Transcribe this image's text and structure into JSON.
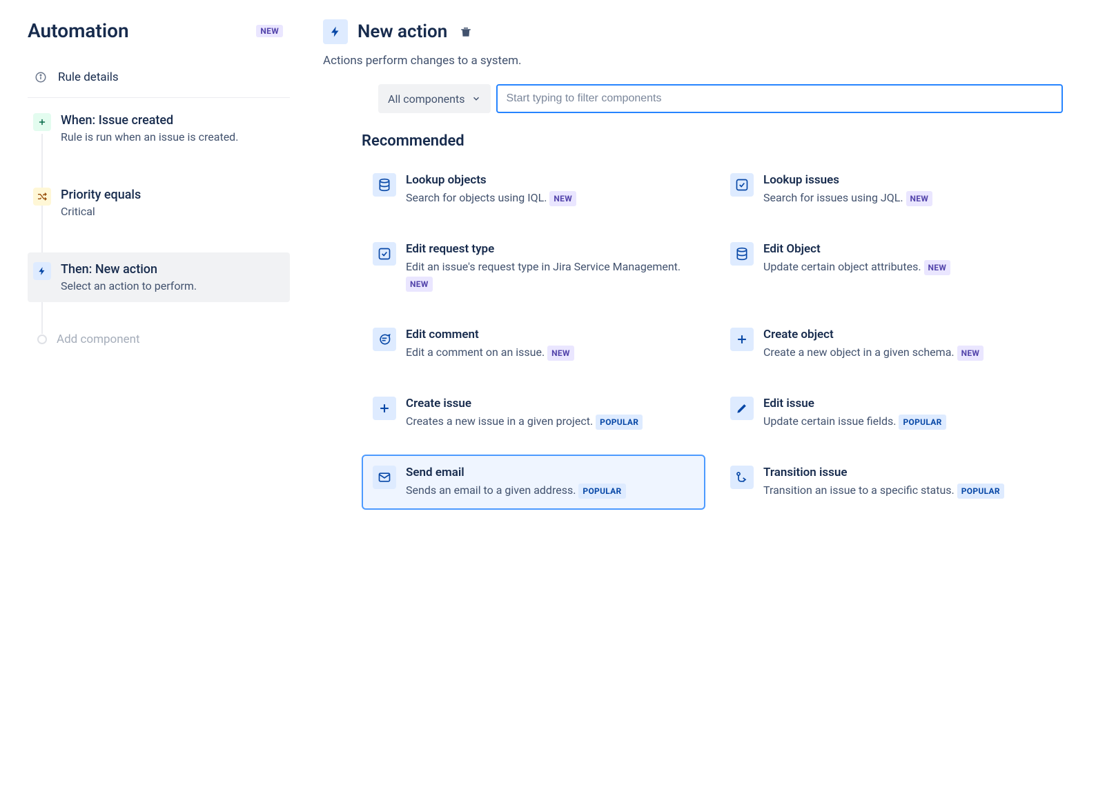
{
  "page": {
    "title": "Automation",
    "badge": "NEW"
  },
  "sidebar": {
    "rule_details_label": "Rule details",
    "steps": [
      {
        "title": "When: Issue created",
        "desc": "Rule is run when an issue is created."
      },
      {
        "title": "Priority equals",
        "desc": "Critical"
      },
      {
        "title": "Then: New action",
        "desc": "Select an action to perform."
      }
    ],
    "add_component_label": "Add component"
  },
  "main": {
    "title": "New action",
    "subtitle": "Actions perform changes to a system.",
    "dropdown_label": "All components",
    "search_placeholder": "Start typing to filter components",
    "section_heading": "Recommended",
    "actions": [
      {
        "title": "Lookup objects",
        "desc": "Search for objects using IQL.",
        "badge": "NEW",
        "badge_type": "new",
        "icon": "database"
      },
      {
        "title": "Lookup issues",
        "desc": "Search for issues using JQL.",
        "badge": "NEW",
        "badge_type": "new",
        "icon": "checkbox"
      },
      {
        "title": "Edit request type",
        "desc": "Edit an issue's request type in Jira Service Management.",
        "badge": "NEW",
        "badge_type": "new",
        "icon": "checkbox"
      },
      {
        "title": "Edit Object",
        "desc": "Update certain object attributes.",
        "badge": "NEW",
        "badge_type": "new",
        "icon": "database"
      },
      {
        "title": "Edit comment",
        "desc": "Edit a comment on an issue.",
        "badge": "NEW",
        "badge_type": "new",
        "icon": "comment"
      },
      {
        "title": "Create object",
        "desc": "Create a new object in a given schema.",
        "badge": "NEW",
        "badge_type": "new",
        "icon": "plus"
      },
      {
        "title": "Create issue",
        "desc": "Creates a new issue in a given project.",
        "badge": "POPULAR",
        "badge_type": "popular",
        "icon": "plus"
      },
      {
        "title": "Edit issue",
        "desc": "Update certain issue fields.",
        "badge": "POPULAR",
        "badge_type": "popular",
        "icon": "pencil"
      },
      {
        "title": "Send email",
        "desc": "Sends an email to a given address.",
        "badge": "POPULAR",
        "badge_type": "popular",
        "icon": "mail",
        "selected": true
      },
      {
        "title": "Transition issue",
        "desc": "Transition an issue to a specific status.",
        "badge": "POPULAR",
        "badge_type": "popular",
        "icon": "transition"
      }
    ]
  }
}
